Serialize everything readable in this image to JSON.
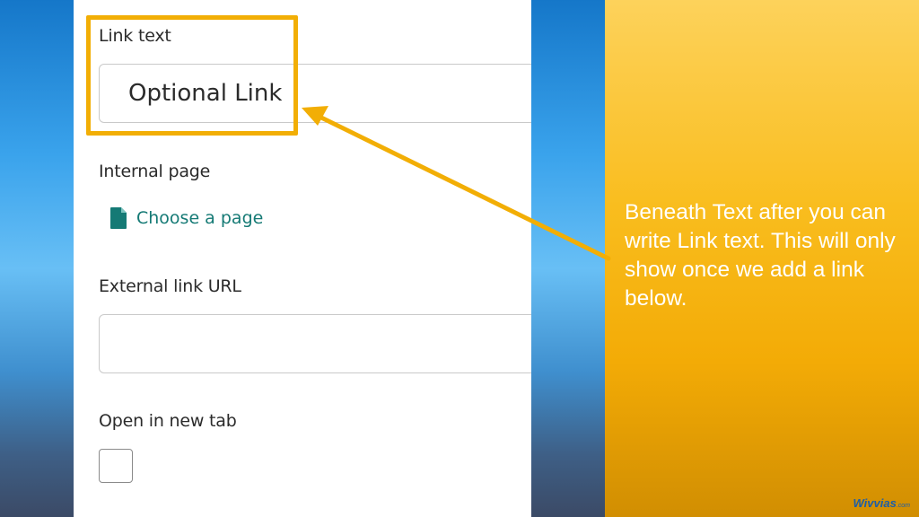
{
  "form": {
    "link_text_label": "Link text",
    "link_text_value": "Optional Link",
    "internal_page_label": "Internal page",
    "choose_page_label": "Choose a page",
    "external_url_label": "External link URL",
    "external_url_value": "",
    "new_tab_label": "Open in new tab",
    "new_tab_checked": false
  },
  "callout": {
    "text": "Beneath Text after you can write Link text. This will only show once we add a link below."
  },
  "brand": {
    "name": "Wivvias",
    "suffix": ".com"
  },
  "colors": {
    "highlight": "#f2ae05",
    "accent_teal": "#157a75",
    "callout_bg": "#f9bd1e"
  },
  "icons": {
    "choose_page": "document-icon"
  }
}
